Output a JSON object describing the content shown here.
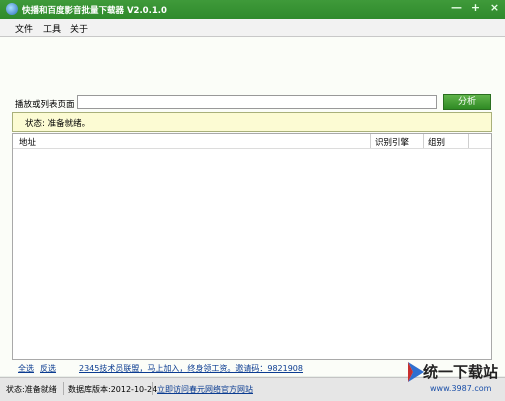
{
  "window": {
    "title": "快播和百度影音批量下载器 V2.0.1.0",
    "min_symbol": "—",
    "max_symbol": "+",
    "close_symbol": "×"
  },
  "menu": [
    "文件",
    "工具",
    "关于"
  ],
  "url_row": {
    "label": "播放或列表页面",
    "value": "",
    "button": "分析"
  },
  "status_box": "状态: 准备就绪。",
  "table": {
    "columns": [
      "地址",
      "识别引擎",
      "组别"
    ]
  },
  "bottom_links": {
    "select_all": "全选",
    "invert": "反选",
    "promo": "2345技术员联盟，马上加入，终身领工资。邀请码：9821908"
  },
  "statusbar": {
    "status": "状态:准备就绪",
    "db_version": "数据库版本:2012-10-24",
    "link": "立即访问春元网络官方网站"
  },
  "watermark": {
    "text": "统一下载站",
    "url": "www.3987.com",
    "icon": "swoosh-logo"
  },
  "colors": {
    "titlebar": "#2f8a2c",
    "button": "#3a9630",
    "status_bg": "#fcfbd3"
  }
}
